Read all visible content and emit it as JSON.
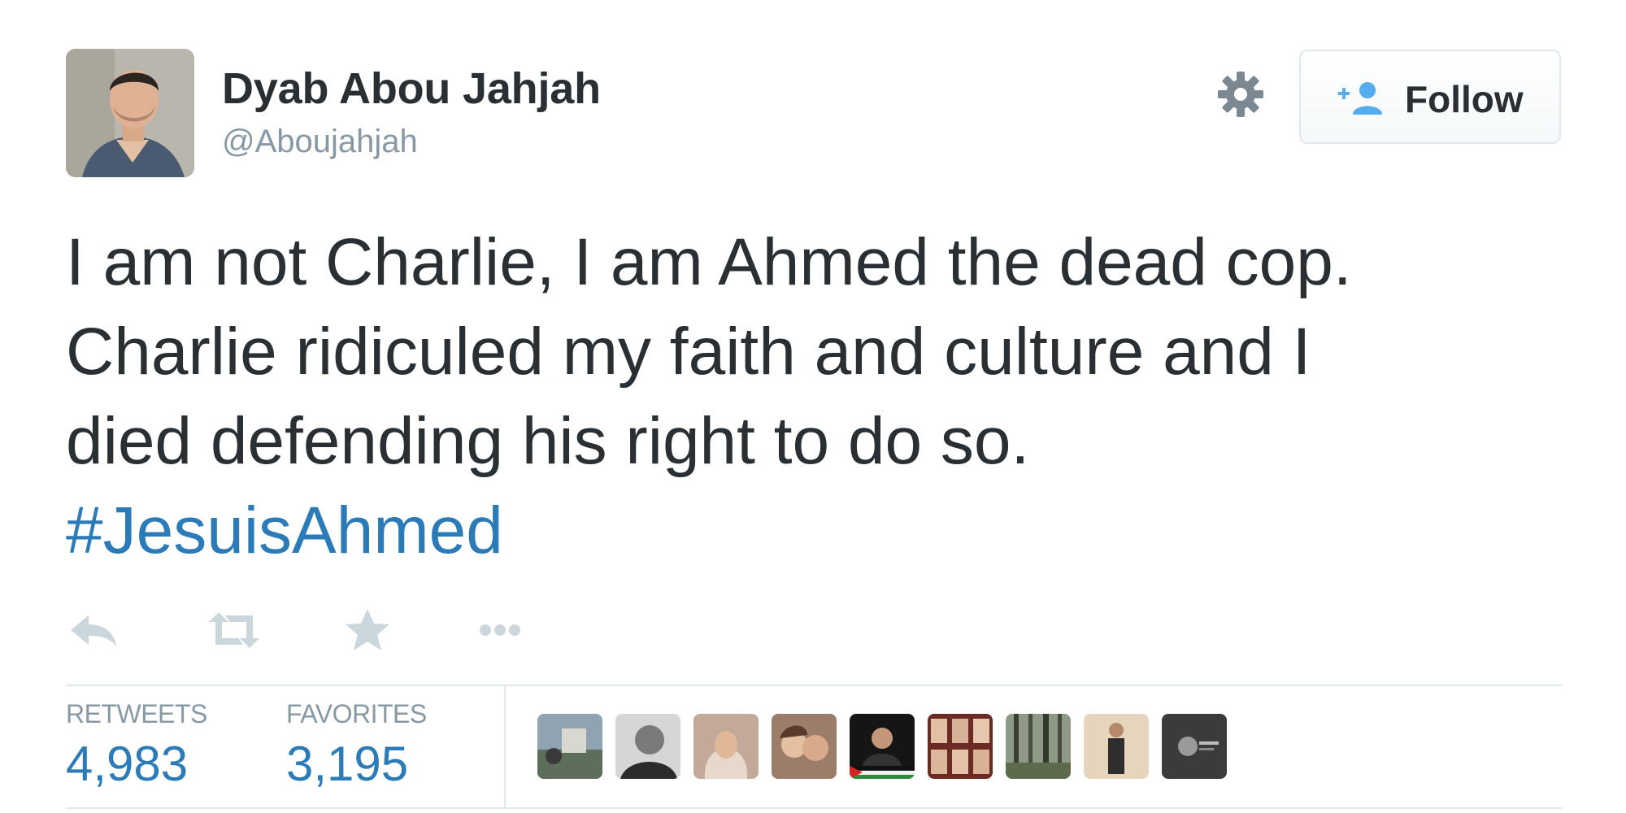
{
  "user": {
    "display_name": "Dyab Abou Jahjah",
    "handle": "@Aboujahjah"
  },
  "follow_button": {
    "label": "Follow",
    "icon": "add-user-icon"
  },
  "settings_icon": "gear-icon",
  "tweet": {
    "lines": [
      "I am not Charlie, I am Ahmed the dead cop.",
      "Charlie ridiculed my faith and culture and I",
      "died defending his right to do so."
    ],
    "hashtag": "#JesuisAhmed"
  },
  "actions": [
    {
      "icon": "reply-icon"
    },
    {
      "icon": "retweet-icon"
    },
    {
      "icon": "favorite-star-icon"
    },
    {
      "icon": "more-dots-icon"
    }
  ],
  "stats": {
    "retweets": {
      "label": "RETWEETS",
      "value": "4,983"
    },
    "favorites": {
      "label": "FAVORITES",
      "value": "3,195"
    }
  },
  "favoriter_avatars_count": 9,
  "colors": {
    "text": "#292f33",
    "muted": "#8899a6",
    "link": "#2b7bb9",
    "border": "#e1e8ed",
    "icon_muted": "#ccd6dd"
  }
}
